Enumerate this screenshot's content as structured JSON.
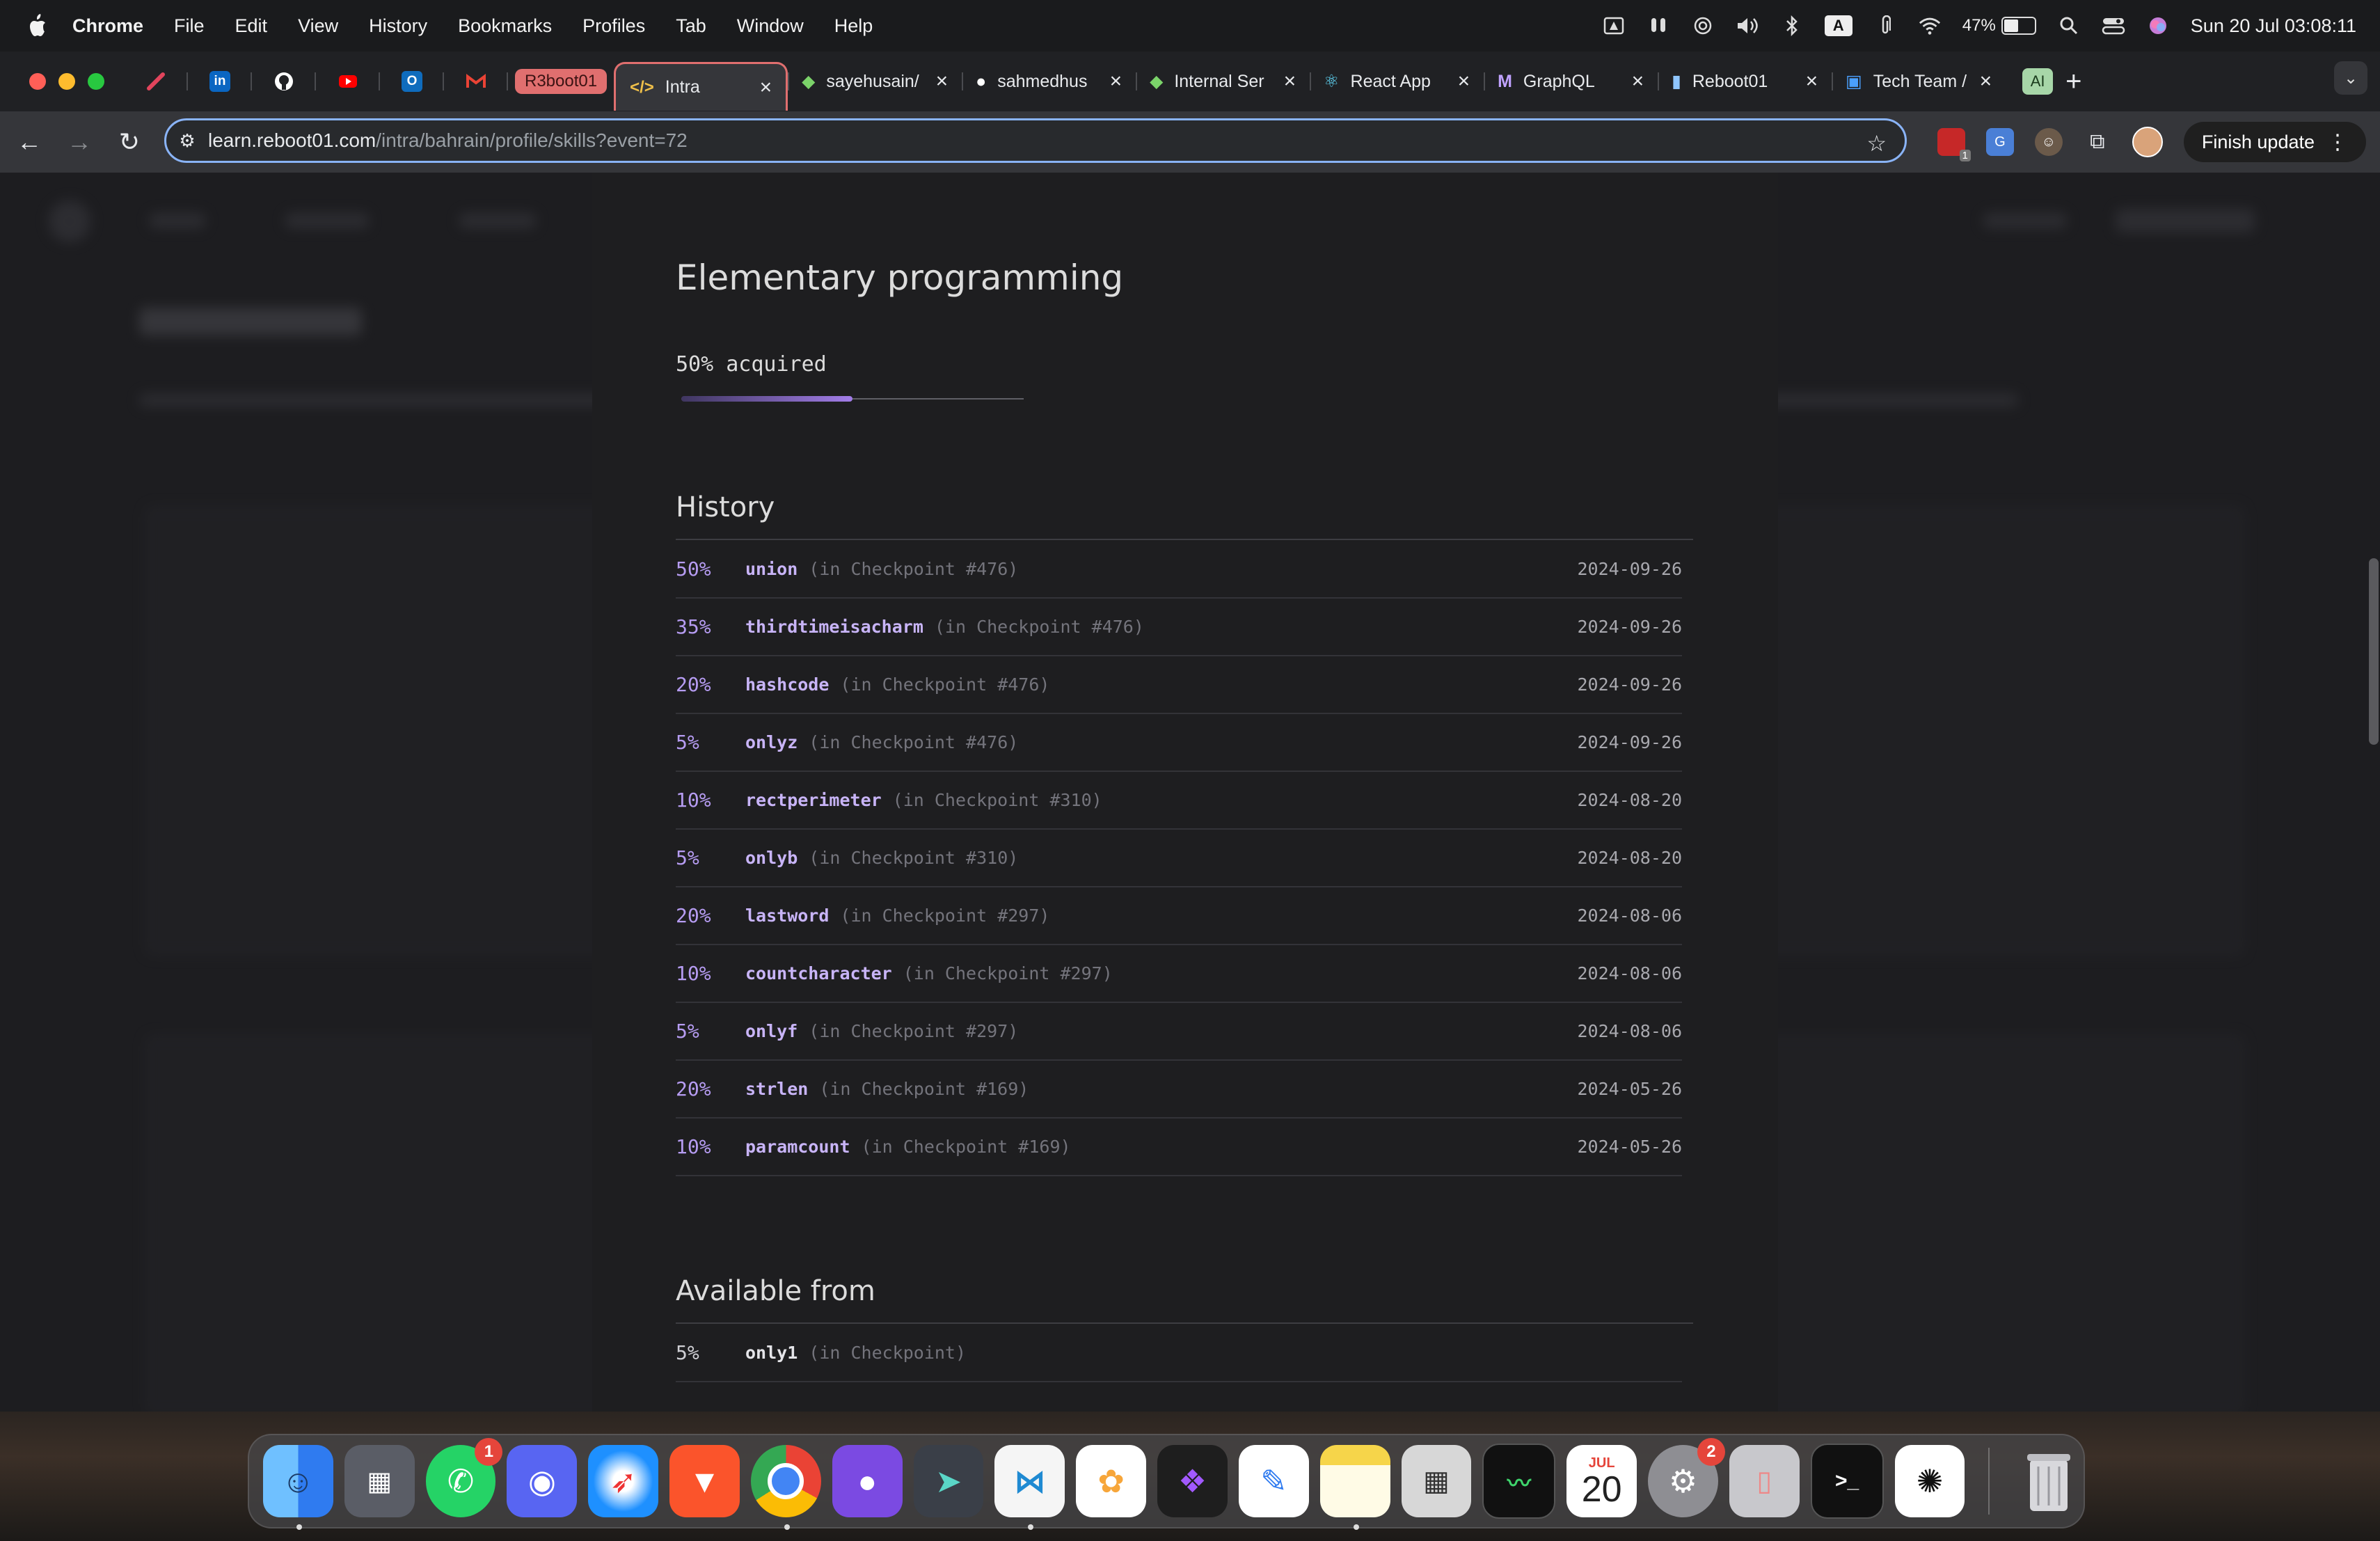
{
  "menubar": {
    "app": "Chrome",
    "items": [
      "File",
      "Edit",
      "View",
      "History",
      "Bookmarks",
      "Profiles",
      "Tab",
      "Window",
      "Help"
    ],
    "battery": "47%",
    "clock": "Sun 20 Jul  03:08:11",
    "input_source": "A"
  },
  "tabs": {
    "group_label": "R3boot01",
    "items": [
      {
        "title": "Intra",
        "icon": "code-icon",
        "active": true
      },
      {
        "title": "sayehusain/",
        "icon": "shield-icon"
      },
      {
        "title": "sahmedhus",
        "icon": "github-icon"
      },
      {
        "title": "Internal Ser",
        "icon": "shield-icon"
      },
      {
        "title": "React App",
        "icon": "react-icon"
      },
      {
        "title": "GraphQL",
        "icon": "graphql-icon"
      },
      {
        "title": "Reboot01",
        "icon": "reboot-icon"
      },
      {
        "title": "Tech Team /",
        "icon": "outlook-icon"
      }
    ],
    "ai_label": "AI"
  },
  "toolbar": {
    "url_host": "learn.reboot01.com",
    "url_path": "/intra/bahrain/profile/skills?event=72",
    "finish_update": "Finish update",
    "ext_badge": "1"
  },
  "skill": {
    "title": "Elementary programming",
    "acquired_text": "50% acquired",
    "acquired_fraction": 0.5
  },
  "history": {
    "heading": "History",
    "rows": [
      {
        "pct": "50%",
        "name": "union",
        "ctx": "(in Checkpoint #476)",
        "date": "2024-09-26"
      },
      {
        "pct": "35%",
        "name": "thirdtimeisacharm",
        "ctx": "(in Checkpoint #476)",
        "date": "2024-09-26"
      },
      {
        "pct": "20%",
        "name": "hashcode",
        "ctx": "(in Checkpoint #476)",
        "date": "2024-09-26"
      },
      {
        "pct": "5%",
        "name": "onlyz",
        "ctx": "(in Checkpoint #476)",
        "date": "2024-09-26"
      },
      {
        "pct": "10%",
        "name": "rectperimeter",
        "ctx": "(in Checkpoint #310)",
        "date": "2024-08-20"
      },
      {
        "pct": "5%",
        "name": "onlyb",
        "ctx": "(in Checkpoint #310)",
        "date": "2024-08-20"
      },
      {
        "pct": "20%",
        "name": "lastword",
        "ctx": "(in Checkpoint #297)",
        "date": "2024-08-06"
      },
      {
        "pct": "10%",
        "name": "countcharacter",
        "ctx": "(in Checkpoint #297)",
        "date": "2024-08-06"
      },
      {
        "pct": "5%",
        "name": "onlyf",
        "ctx": "(in Checkpoint #297)",
        "date": "2024-08-06"
      },
      {
        "pct": "20%",
        "name": "strlen",
        "ctx": "(in Checkpoint #169)",
        "date": "2024-05-26"
      },
      {
        "pct": "10%",
        "name": "paramcount",
        "ctx": "(in Checkpoint #169)",
        "date": "2024-05-26"
      }
    ]
  },
  "available": {
    "heading": "Available from",
    "rows": [
      {
        "pct": "5%",
        "name": "only1",
        "ctx": "(in Checkpoint)"
      }
    ]
  },
  "dock": {
    "calendar_month": "JUL",
    "calendar_day": "20",
    "whatsapp_badge": "1",
    "settings_badge": "2",
    "apps": [
      "finder-icon",
      "launchpad-icon",
      "whatsapp-icon",
      "discord-icon",
      "safari-icon",
      "brave-icon",
      "chrome-icon",
      "github-desktop-icon",
      "vpn-icon",
      "vscode-icon",
      "photos-icon",
      "figma-icon",
      "freeform-icon",
      "notes-icon",
      "calculator-icon",
      "activity-monitor-icon",
      "calendar-icon",
      "system-settings-icon",
      "iphone-mirroring-icon",
      "terminal-icon",
      "chatgpt-icon",
      "trash-icon"
    ]
  }
}
